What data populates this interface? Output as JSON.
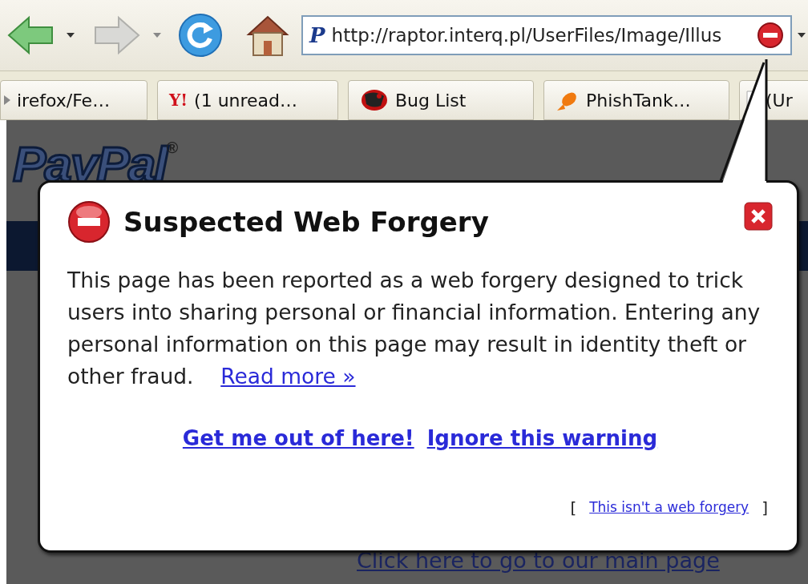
{
  "toolbar": {
    "favicon": "P",
    "url": "http://raptor.interq.pl/UserFiles/Image/Illus"
  },
  "tabs": [
    {
      "kind": "scrolled",
      "label": "irefox/Fe…"
    },
    {
      "kind": "yahoo",
      "icon_text": "Y!",
      "label": "(1 unread…"
    },
    {
      "kind": "bug",
      "label": "Bug List"
    },
    {
      "kind": "fish",
      "label": "PhishTank…"
    },
    {
      "kind": "blank",
      "label": "(Ur"
    }
  ],
  "page": {
    "logo": "PayPal",
    "logo_mark": "®",
    "link": "Click here to go to our main page"
  },
  "warning": {
    "title": "Suspected Web Forgery",
    "message": "This page has been reported as a web forgery designed to trick users into sharing personal or financial information. Entering any personal information on this page may result in identity theft or other fraud.",
    "read_more": "Read more »",
    "actions": [
      "Get me out of here!",
      "Ignore this warning"
    ],
    "footer_open": "[",
    "footer_link": "This isn't a web forgery",
    "footer_close": "]"
  }
}
